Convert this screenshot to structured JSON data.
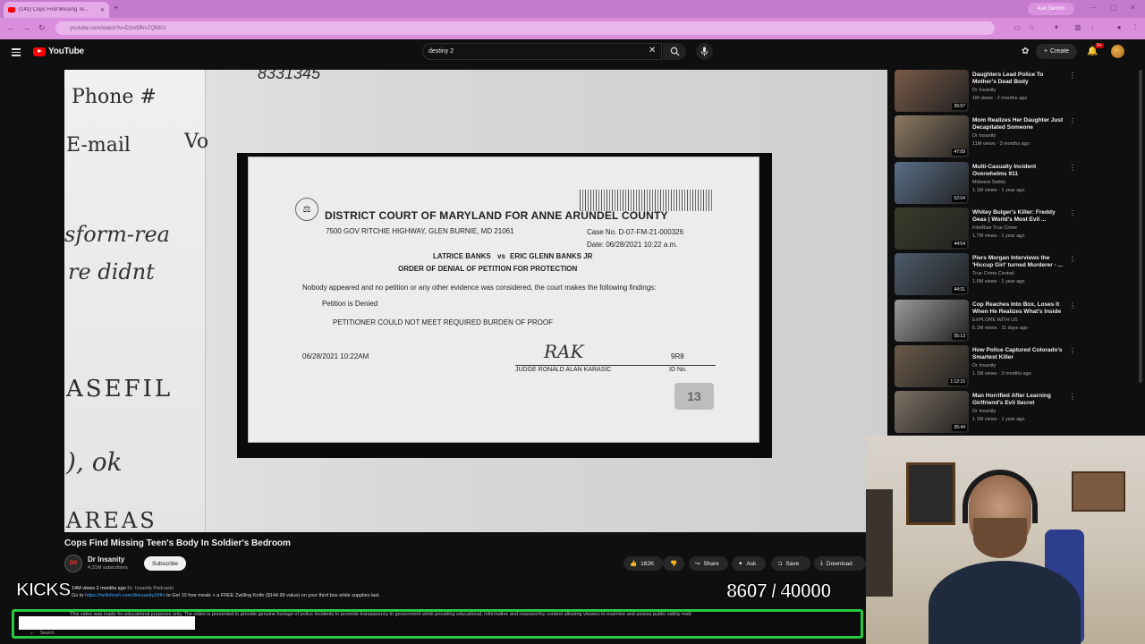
{
  "browser": {
    "tab_title": "(143) Cops Find Missing Te...",
    "url": "youtube.com/watch?v=D2m5Rm7QNKU",
    "ask_gemini": "Ask Gemini"
  },
  "header": {
    "logo_text": "YouTube",
    "search_value": "destiny 2",
    "create_label": "Create",
    "notification_badge": "9+"
  },
  "video_frame": {
    "doc_number": "8331345",
    "left_paper": {
      "phone_label": "Phone #",
      "email_label": "E-mail",
      "email_trail": "Vo",
      "hand1": "sform-rea",
      "hand2": "re didnt",
      "hand3": "ASEFIL",
      "hand4": "), ok",
      "hand5": "AREAS"
    },
    "court_doc": {
      "title": "DISTRICT COURT OF MARYLAND FOR ANNE ARUNDEL COUNTY",
      "address": "7500 GOV RITCHIE HIGHWAY, GLEN BURNIE, MD 21061",
      "case_no": "Case No. D-07-FM-21-000326",
      "date_line": "Date: 06/28/2021 10:22 a.m.",
      "parties_left": "LATRICE BANKS",
      "vs": "vs",
      "parties_right": "ERIC GLENN BANKS JR",
      "order": "ORDER OF DENIAL OF PETITION FOR PROTECTION",
      "finding": "Nobody appeared and no petition or any other evidence was considered, the court makes the following findings:",
      "denied": "Petition is Denied",
      "burden": "PETITIONER COULD NOT MEET REQUIRED BURDEN OF PROOF",
      "signed_date": "06/28/2021 10:22AM",
      "judge": "JUDGE RONALD ALAN KARASIC",
      "id_value": "9R8",
      "id_label": "ID No.",
      "station_logo": "13"
    }
  },
  "video": {
    "title": "Cops Find Missing Teen's Body In Soldier's Bedroom",
    "channel": "Dr Insanity",
    "subscribers": "4.31M subscribers",
    "subscribe_label": "Subscribe",
    "likes": "182K",
    "share_label": "Share",
    "ask_label": "Ask",
    "save_label": "Save",
    "download_label": "Download",
    "meta_views": "14M views  2 months ago",
    "meta_tag": "Dr. Insanity Podcasts",
    "desc_prefix": "Go to ",
    "desc_link": "https://hellofresh.com/drinsanity10fm",
    "desc_suffix": " to Get 10 free meals + a FREE Zwilling Knife ($144.99 value) on your third box while supplies last."
  },
  "recommendations": [
    {
      "title": "Daughters Lead Police To Mother's Dead Body",
      "channel": "Dr Insanity",
      "meta": "1M views · 2 months ago",
      "duration": "35:57",
      "color": "#7a5a48"
    },
    {
      "title": "Mom Realizes Her Daughter Just Decapitated Someone",
      "channel": "Dr Insanity",
      "meta": "11M views · 3 months ago",
      "duration": "47:09",
      "color": "#8d7a62"
    },
    {
      "title": "Multi-Casualty Incident Overwhelms 911",
      "channel": "Midwest Safety",
      "meta": "1.1M views · 1 year ago",
      "duration": "52:04",
      "color": "#5a6f88"
    },
    {
      "title": "Whitey Bulger's Killer: Freddy Geas | World's Most Evil ...",
      "channel": "FilmRise True Crime",
      "meta": "1.7M views · 1 year ago",
      "duration": "44:54",
      "color": "#3b3b2b"
    },
    {
      "title": "Piers Morgan Interviews the 'Hiccup Girl' turned Murderer - ...",
      "channel": "True Crime Central",
      "meta": "1.5M views · 1 year ago",
      "duration": "44:31",
      "color": "#4d5a6a"
    },
    {
      "title": "Cop Reaches Into Box, Loses It When He Realizes What's Inside",
      "channel": "EXPLORE WITH US",
      "meta": "5.1M views · 11 days ago",
      "duration": "55:13",
      "color": "#9a9a9a"
    },
    {
      "title": "How Police Captured Colorado's Smartest Killer",
      "channel": "Dr Insanity",
      "meta": "1.1M views · 3 months ago",
      "duration": "1:12:15",
      "color": "#6b5a4a"
    },
    {
      "title": "Man Horrified After Learning Girlfriend's Evil Secret",
      "channel": "Dr Insanity",
      "meta": "1.1M views · 1 year ago",
      "duration": "35:44",
      "color": "#7c7064"
    }
  ],
  "stream_overlay": {
    "kicks_label": "KICKS",
    "counter": "8607 / 40000",
    "disclaimer": "This video was made for educational purposes only. The video is presented to provide genuine footage of police incidents to promote transparency in government while providing educational, informative and newsworthy content allowing viewers to examine and assess public safety matt",
    "taskbar_search": "Search"
  },
  "colors": {
    "accent_green": "#27c93f",
    "youtube_red": "#ff0000",
    "browser_pink": "#d98edd"
  }
}
